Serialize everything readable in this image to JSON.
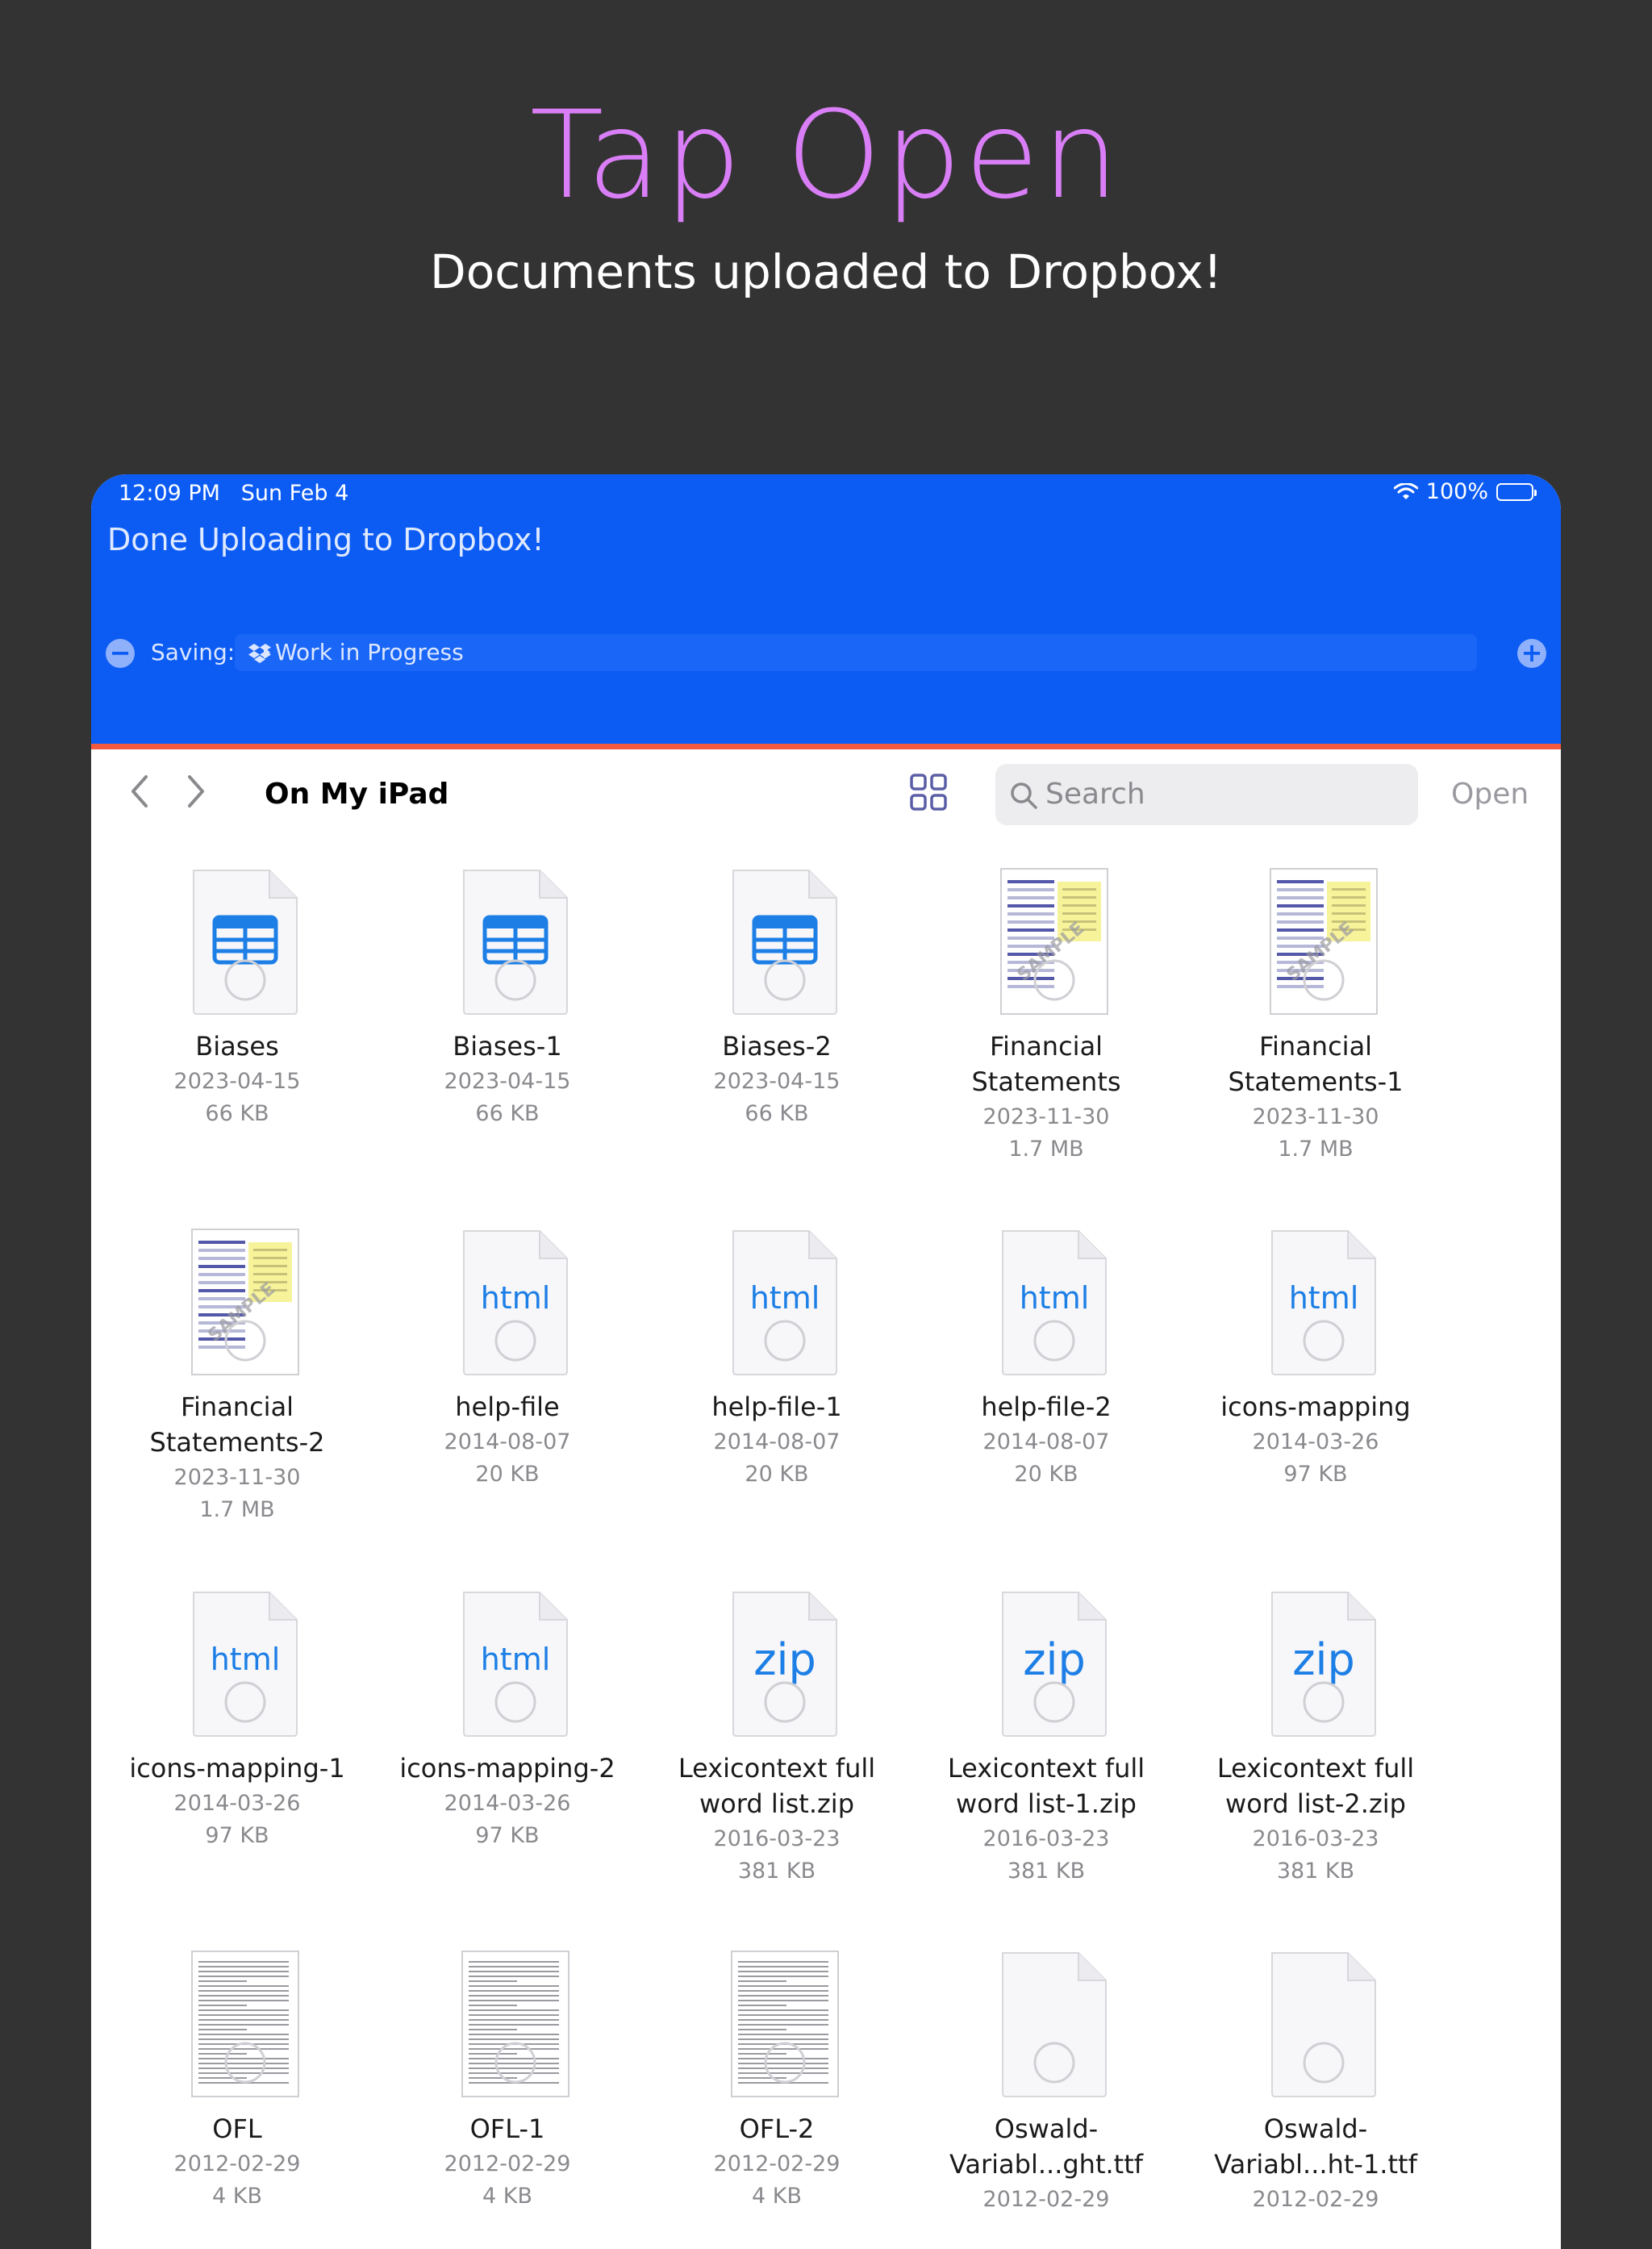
{
  "promo": {
    "title": "Tap Open",
    "subtitle": "Documents uploaded to Dropbox!"
  },
  "status_bar": {
    "time": "12:09 PM",
    "date": "Sun Feb 4",
    "battery": "100%"
  },
  "upload": {
    "message": "Done Uploading to Dropbox!",
    "saving_label": "Saving:",
    "path": "Work in Progress"
  },
  "nav": {
    "title": "On My iPad",
    "search_placeholder": "Search",
    "open_label": "Open"
  },
  "colors": {
    "accent": "#0c5cf4",
    "title_color": "#d97ef6",
    "divider": "#f15a3f"
  },
  "files": [
    {
      "name": "Biases",
      "date": "2023-04-15",
      "size": "66 KB",
      "kind": "numbers"
    },
    {
      "name": "Biases-1",
      "date": "2023-04-15",
      "size": "66 KB",
      "kind": "numbers"
    },
    {
      "name": "Biases-2",
      "date": "2023-04-15",
      "size": "66 KB",
      "kind": "numbers"
    },
    {
      "name": "Financial\nStatements",
      "date": "2023-11-30",
      "size": "1.7 MB",
      "kind": "pdf"
    },
    {
      "name": "Financial\nStatements-1",
      "date": "2023-11-30",
      "size": "1.7 MB",
      "kind": "pdf"
    },
    {
      "name": "Financial\nStatements-2",
      "date": "2023-11-30",
      "size": "1.7 MB",
      "kind": "pdf"
    },
    {
      "name": "help-file",
      "date": "2014-08-07",
      "size": "20 KB",
      "kind": "html"
    },
    {
      "name": "help-file-1",
      "date": "2014-08-07",
      "size": "20 KB",
      "kind": "html"
    },
    {
      "name": "help-file-2",
      "date": "2014-08-07",
      "size": "20 KB",
      "kind": "html"
    },
    {
      "name": "icons-mapping",
      "date": "2014-03-26",
      "size": "97 KB",
      "kind": "html"
    },
    {
      "name": "icons-mapping-1",
      "date": "2014-03-26",
      "size": "97 KB",
      "kind": "html"
    },
    {
      "name": "icons-mapping-2",
      "date": "2014-03-26",
      "size": "97 KB",
      "kind": "html"
    },
    {
      "name": "Lexicontext full\nword list.zip",
      "date": "2016-03-23",
      "size": "381 KB",
      "kind": "zip"
    },
    {
      "name": "Lexicontext full\nword list-1.zip",
      "date": "2016-03-23",
      "size": "381 KB",
      "kind": "zip"
    },
    {
      "name": "Lexicontext full\nword list-2.zip",
      "date": "2016-03-23",
      "size": "381 KB",
      "kind": "zip"
    },
    {
      "name": "OFL",
      "date": "2012-02-29",
      "size": "4 KB",
      "kind": "text"
    },
    {
      "name": "OFL-1",
      "date": "2012-02-29",
      "size": "4 KB",
      "kind": "text"
    },
    {
      "name": "OFL-2",
      "date": "2012-02-29",
      "size": "4 KB",
      "kind": "text"
    },
    {
      "name": "Oswald-\nVariabl...ght.ttf",
      "date": "2012-02-29",
      "size": "",
      "kind": "blank"
    },
    {
      "name": "Oswald-\nVariabl...ht-1.ttf",
      "date": "2012-02-29",
      "size": "",
      "kind": "blank"
    }
  ]
}
